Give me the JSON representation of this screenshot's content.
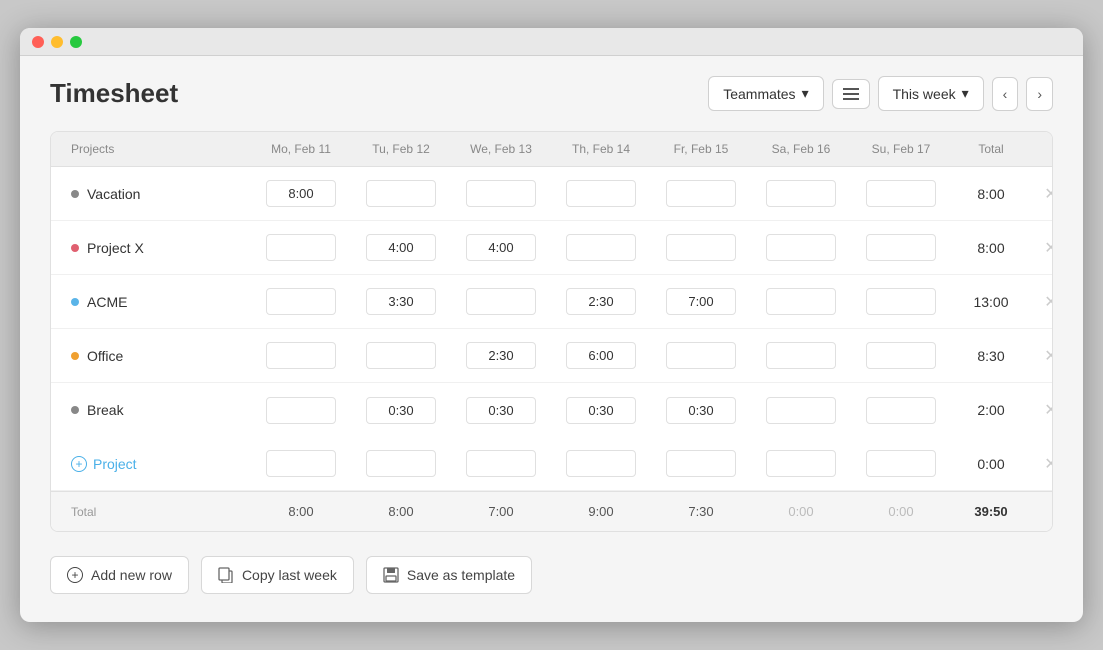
{
  "window": {
    "title": "Timesheet"
  },
  "header": {
    "title": "Timesheet",
    "teammates_label": "Teammates",
    "week_label": "This week"
  },
  "table": {
    "columns": {
      "projects": "Projects",
      "days": [
        "Mo, Feb 11",
        "Tu, Feb 12",
        "We, Feb 13",
        "Th, Feb 14",
        "Fr, Feb 15",
        "Sa, Feb 16",
        "Su, Feb 17"
      ],
      "total": "Total"
    },
    "rows": [
      {
        "project": "Vacation",
        "color": "#888888",
        "times": [
          "8:00",
          "",
          "",
          "",
          "",
          "",
          ""
        ],
        "total": "8:00"
      },
      {
        "project": "Project X",
        "color": "#e06070",
        "times": [
          "",
          "4:00",
          "4:00",
          "",
          "",
          "",
          ""
        ],
        "total": "8:00"
      },
      {
        "project": "ACME",
        "color": "#5ab4e8",
        "times": [
          "",
          "3:30",
          "",
          "2:30",
          "7:00",
          "",
          ""
        ],
        "total": "13:00"
      },
      {
        "project": "Office",
        "color": "#f0a030",
        "times": [
          "",
          "",
          "2:30",
          "6:00",
          "",
          "",
          ""
        ],
        "total": "8:30"
      },
      {
        "project": "Break",
        "color": "#888888",
        "times": [
          "",
          "0:30",
          "0:30",
          "0:30",
          "0:30",
          "",
          ""
        ],
        "total": "2:00"
      }
    ],
    "add_project_label": "Project",
    "totals": {
      "label": "Total",
      "values": [
        "8:00",
        "8:00",
        "7:00",
        "9:00",
        "7:30",
        "0:00",
        "0:00"
      ],
      "grand_total": "39:50"
    }
  },
  "footer": {
    "add_row_label": "Add new row",
    "copy_label": "Copy last week",
    "save_template_label": "Save as template"
  }
}
